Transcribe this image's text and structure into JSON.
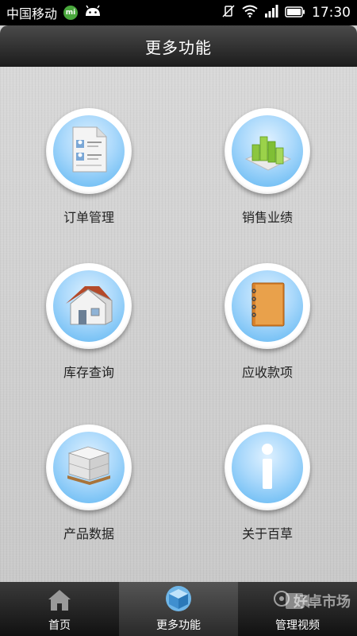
{
  "status_bar": {
    "carrier": "中国移动",
    "mi_badge": "mi",
    "time": "17:30"
  },
  "header": {
    "title": "更多功能"
  },
  "tiles": [
    {
      "label": "订单管理",
      "icon": "order-document-icon"
    },
    {
      "label": "销售业绩",
      "icon": "bar-chart-icon"
    },
    {
      "label": "库存查询",
      "icon": "house-icon"
    },
    {
      "label": "应收款项",
      "icon": "notebook-icon"
    },
    {
      "label": "产品数据",
      "icon": "pallet-boxes-icon"
    },
    {
      "label": "关于百草",
      "icon": "info-icon"
    }
  ],
  "bottom_nav": {
    "items": [
      {
        "label": "首页",
        "icon": "home-icon"
      },
      {
        "label": "更多功能",
        "icon": "cube-icon",
        "active": true
      },
      {
        "label": "管理视频",
        "icon": "video-icon"
      }
    ],
    "watermark": "好卓市场"
  },
  "colors": {
    "header_dark": "#1c1c1c",
    "disc_blue": "#5ab4f1",
    "nav_dark": "#111111"
  }
}
